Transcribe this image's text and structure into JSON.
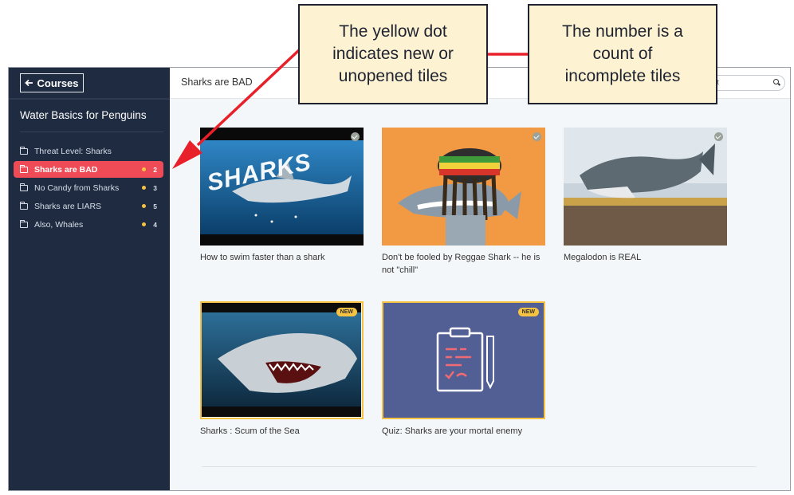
{
  "sidebar": {
    "back_label": "Courses",
    "course_title": "Water Basics for Penguins",
    "items": [
      {
        "label": "Threat Level: Sharks",
        "count": ""
      },
      {
        "label": "Sharks are BAD",
        "count": "2"
      },
      {
        "label": "No Candy from Sharks",
        "count": "3"
      },
      {
        "label": "Sharks are LIARS",
        "count": "5"
      },
      {
        "label": "Also, Whales",
        "count": "4"
      }
    ]
  },
  "header": {
    "title": "Sharks are BAD",
    "search_placeholder": "ntent"
  },
  "tiles": [
    {
      "title": "How to swim faster than a shark",
      "thumb_text": "SHARKS"
    },
    {
      "title": "Don't be fooled by Reggae Shark -- he is not \"chill\""
    },
    {
      "title": "Megalodon is REAL"
    },
    {
      "title": "Sharks : Scum of the Sea",
      "badge": "NEW"
    },
    {
      "title": "Quiz: Sharks are your mortal enemy",
      "badge": "NEW"
    }
  ],
  "annotations": {
    "dot_callout": {
      "line1": "The yellow dot",
      "line2": "indicates new or",
      "line3": "unopened tiles"
    },
    "number_callout": {
      "line1": "The number is a",
      "line2": "count of",
      "line3": "incomplete tiles"
    }
  },
  "colors": {
    "sidebar_bg": "#1e2b40",
    "active_item": "#ef4b57",
    "new_dot": "#f5c242",
    "annotation_arrow": "#e8202a"
  }
}
